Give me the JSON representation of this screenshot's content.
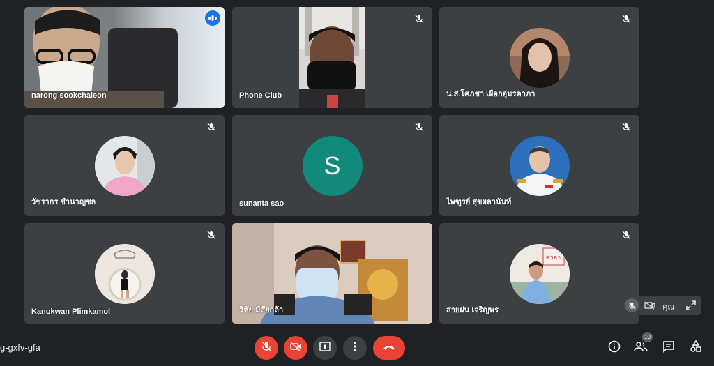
{
  "participants": [
    {
      "name": "narong sookchaleon",
      "initial": "",
      "active": true
    },
    {
      "name": "Phone Club",
      "initial": ""
    },
    {
      "name": "น.ส.โศภชา เผือกอุ่มรคาภา",
      "initial": ""
    },
    {
      "name": "วัชรากร ชำนาญชล",
      "initial": ""
    },
    {
      "name": "sunanta sao",
      "initial": "S"
    },
    {
      "name": "ไพฑูรย์ สุขผลานันท์",
      "initial": ""
    },
    {
      "name": "Kanokwan Plimkamol",
      "initial": ""
    },
    {
      "name": "วิชัย มีสัยกล้า",
      "initial": ""
    },
    {
      "name": "สายฝน เจริญพร",
      "initial": ""
    }
  ],
  "self_view": {
    "label": "คุณ"
  },
  "meeting": {
    "code": "g-gxfv-gfa"
  },
  "people_count": "10",
  "icons": {
    "mic": "mic-off-icon",
    "cam": "videocam-off-icon",
    "present": "present-icon",
    "more": "more-vert-icon",
    "end": "call-end-icon",
    "info": "info-icon",
    "people": "people-icon",
    "chat": "chat-icon",
    "activities": "activities-icon"
  },
  "colors": {
    "end_call": "#ea4335",
    "avatar_s": "#128a7b",
    "active_border": "#8ab4f8"
  }
}
